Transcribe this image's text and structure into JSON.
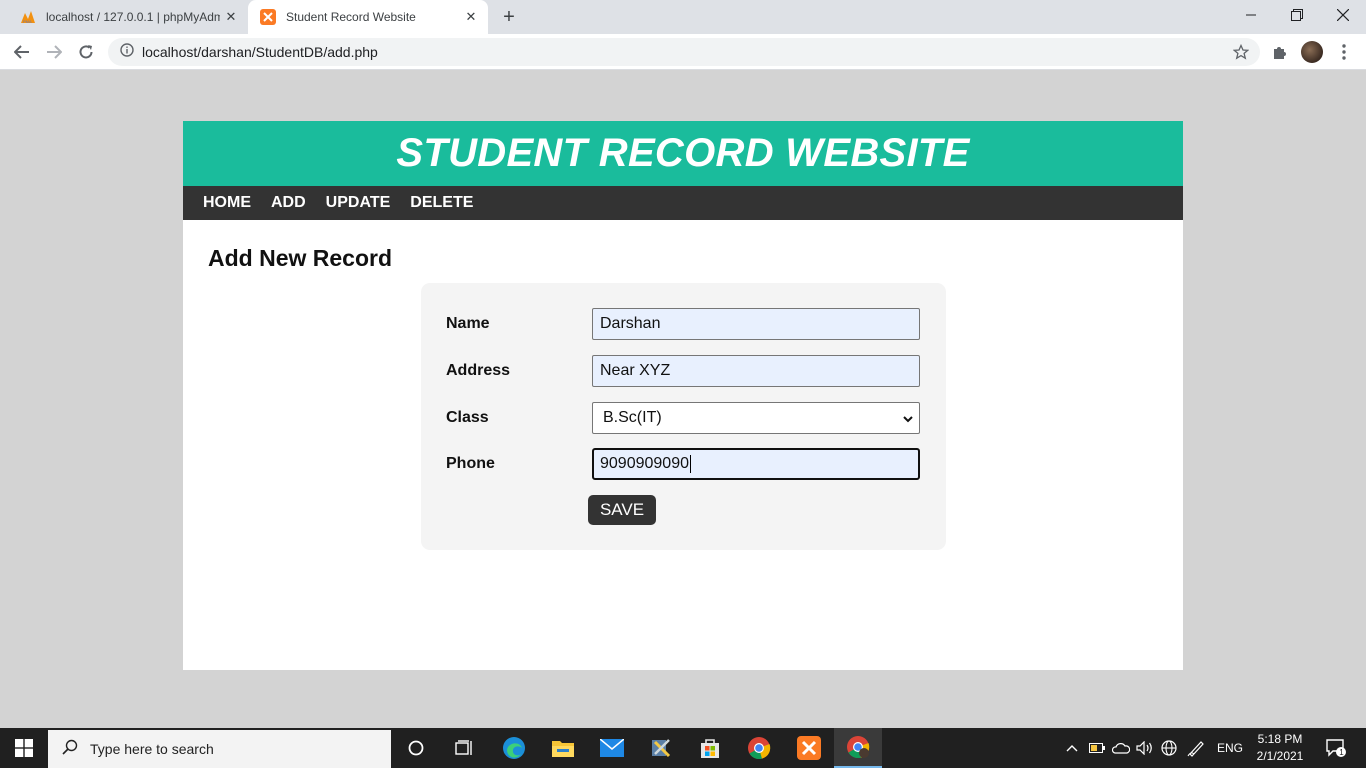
{
  "browser": {
    "tabs": [
      {
        "title": "localhost / 127.0.0.1 | phpMyAdm",
        "active": false,
        "icon": "phpmyadmin-icon"
      },
      {
        "title": "Student Record Website",
        "active": true,
        "icon": "xampp-icon"
      }
    ],
    "url": "localhost/darshan/StudentDB/add.php"
  },
  "site": {
    "header": "STUDENT RECORD WEBSITE",
    "nav": [
      "HOME",
      "ADD",
      "UPDATE",
      "DELETE"
    ],
    "page_heading": "Add New Record",
    "form": {
      "name_label": "Name",
      "name_value": "Darshan",
      "address_label": "Address",
      "address_value": "Near XYZ",
      "class_label": "Class",
      "class_value": "B.Sc(IT)",
      "phone_label": "Phone",
      "phone_value": "9090909090",
      "save_label": "SAVE"
    }
  },
  "taskbar": {
    "search_placeholder": "Type here to search",
    "language": "ENG",
    "time": "5:18 PM",
    "date": "2/1/2021",
    "notification_count": "1"
  },
  "colors": {
    "header_bg": "#1abc9c",
    "nav_bg": "#333333",
    "form_bg": "#f4f4f4",
    "autofill_bg": "#e8f0fe"
  }
}
